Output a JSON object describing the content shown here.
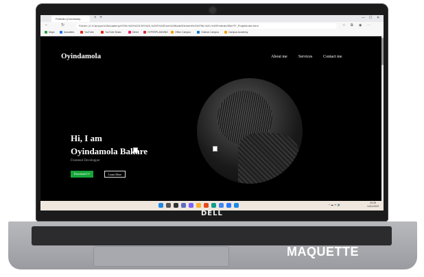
{
  "browser": {
    "tab_title": "Portfolio (Commonly",
    "tab_close": "×",
    "new_tab": "+",
    "win_min": "—",
    "win_max": "☐",
    "win_close": "✕",
    "nav_back": "←",
    "nav_refresh": "↻",
    "url": "Fichier | E:/Campus%20Academy/HTML%20%20CSS%20-%20S%20Fam%20Bulle/Element%20HTML%20-%20Portfolio/Site/TF_Projet/index.html",
    "bookmarks": [
      {
        "label": "Maps",
        "color": "#2e9e4a"
      },
      {
        "label": "Actualités",
        "color": "#1a73e8"
      },
      {
        "label": "YouTube",
        "color": "#e62117"
      },
      {
        "label": "YouTube Music",
        "color": "#e62117"
      },
      {
        "label": "Direct",
        "color": "#e91e63"
      },
      {
        "label": "HYPERPLANNING",
        "color": "#d32f2f"
      },
      {
        "label": "Office Campus",
        "color": "#f0a30a"
      },
      {
        "label": "Outlook Campus",
        "color": "#0078d4"
      },
      {
        "label": "Campus Academy",
        "color": "#f0a30a"
      }
    ]
  },
  "site": {
    "title": "Oyindamola",
    "nav": [
      "About me",
      "Services",
      "Contact me"
    ],
    "hero_line1": "Hi, I am",
    "hero_line2": "Oyindamola Bakare",
    "role": "Frontend Developper",
    "btn_cv": "Download CV",
    "btn_more": "Learn More"
  },
  "taskbar": {
    "icons": [
      {
        "name": "start-icon",
        "color": "#1e88e5"
      },
      {
        "name": "search-icon",
        "color": "#555555"
      },
      {
        "name": "task-view-icon",
        "color": "#333333"
      },
      {
        "name": "widgets-icon",
        "color": "#5c6bc0"
      },
      {
        "name": "chat-icon",
        "color": "#7b61ff"
      },
      {
        "name": "file-explorer-icon",
        "color": "#f9b233"
      },
      {
        "name": "office-icon",
        "color": "#e64a19"
      },
      {
        "name": "edge-icon",
        "color": "#0f9d8f"
      },
      {
        "name": "chrome-icon",
        "color": "#4285f4"
      },
      {
        "name": "store-icon",
        "color": "#2979ff"
      },
      {
        "name": "vscode-icon",
        "color": "#1e88e5"
      }
    ],
    "tray": "^ ☁ ᯤ 🔊",
    "time": "09:28",
    "date": "14/11/2023"
  },
  "device": {
    "brand": "DELL",
    "caption": "MAQUETTE"
  }
}
